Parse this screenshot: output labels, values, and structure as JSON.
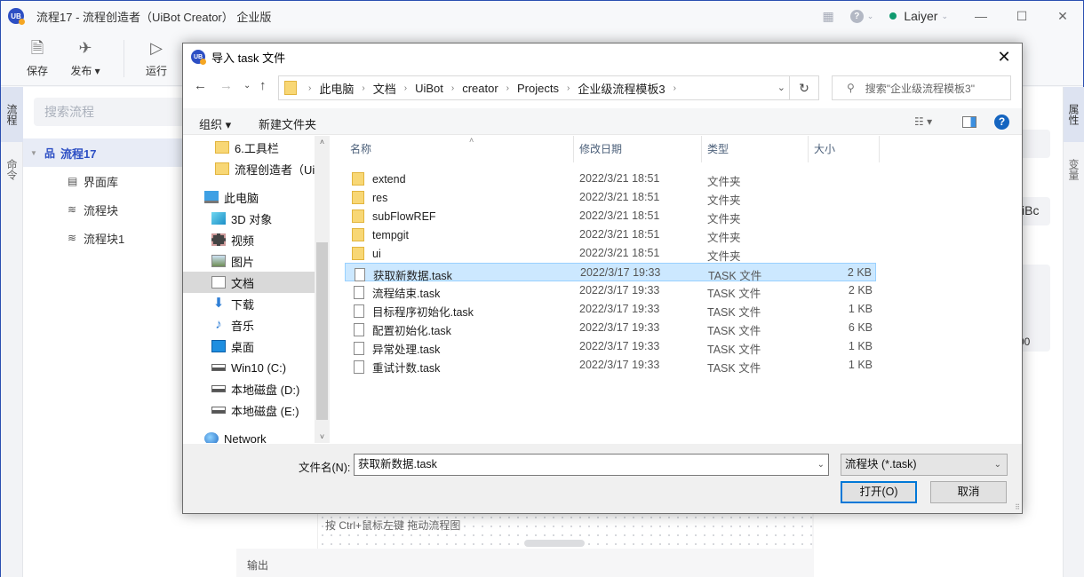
{
  "app": {
    "logo_text": "UB",
    "title": "流程17 - 流程创造者（UiBot Creator） 企业版",
    "user_name": "Laiyer",
    "status_color": "#0f9a6f",
    "icons": {
      "apps": "▦",
      "help": "?",
      "chevron": "⌄",
      "minimize": "—",
      "maximize": "☐",
      "close": "✕"
    }
  },
  "toolbar": {
    "items": [
      {
        "label": "保存",
        "icon": "🗎"
      },
      {
        "label": "发布 ▾",
        "icon": "✈"
      },
      {
        "label": "运行",
        "icon": "▷"
      }
    ]
  },
  "left_strip": {
    "tabs": [
      "流程",
      "命令"
    ]
  },
  "left_panel": {
    "search_placeholder": "搜索流程",
    "tree": [
      {
        "label": "流程17",
        "icon": "品",
        "caret": "▼"
      },
      {
        "label": "界面库",
        "icon": "▤"
      },
      {
        "label": "流程块",
        "icon": "≋"
      },
      {
        "label": "流程块1",
        "icon": "≋"
      }
    ]
  },
  "center": {
    "canvas_hint": "按 Ctrl+鼠标左键 拖动流程图",
    "output_label": "输出"
  },
  "right_panel": {
    "partial_text_1": "iBc",
    "partial_text_2": "00"
  },
  "right_strip": {
    "tabs": [
      "属性",
      "变量"
    ]
  },
  "dialog": {
    "title": "导入 task 文件",
    "close_icon": "✕",
    "nav": {
      "back": "←",
      "forward": "→",
      "recent": "⌄",
      "up": "↑",
      "refresh": "↻"
    },
    "breadcrumb": [
      "此电脑",
      "文档",
      "UiBot",
      "creator",
      "Projects",
      "企业级流程模板3"
    ],
    "crumb_sep": "›",
    "addr_dropdown": "⌄",
    "search_placeholder": "搜索\"企业级流程模板3\"",
    "search_icon": "⚲",
    "commands": {
      "organize": "组织 ▾",
      "new_folder": "新建文件夹",
      "view_icon": "☷ ▾",
      "help": "?"
    },
    "nav_pane": [
      {
        "label": "6.工具栏",
        "icon": "folder"
      },
      {
        "label": "流程创造者（UiBot Creator）",
        "icon": "folder"
      },
      {
        "label": "此电脑",
        "icon": "pc"
      },
      {
        "label": "3D 对象",
        "icon": "3d"
      },
      {
        "label": "视频",
        "icon": "video"
      },
      {
        "label": "图片",
        "icon": "pic"
      },
      {
        "label": "文档",
        "icon": "doc",
        "selected": true
      },
      {
        "label": "下载",
        "icon": "dl"
      },
      {
        "label": "音乐",
        "icon": "music"
      },
      {
        "label": "桌面",
        "icon": "desk"
      },
      {
        "label": "Win10 (C:)",
        "icon": "drive"
      },
      {
        "label": "本地磁盘 (D:)",
        "icon": "drive"
      },
      {
        "label": "本地磁盘 (E:)",
        "icon": "drive"
      },
      {
        "label": "Network",
        "icon": "net"
      }
    ],
    "scroll": {
      "up": "˄",
      "down": "˅"
    },
    "columns": {
      "name": "名称",
      "date": "修改日期",
      "type": "类型",
      "size": "大小",
      "sort_indicator": "˄"
    },
    "files": [
      {
        "name": "extend",
        "date": "2022/3/21 18:51",
        "type": "文件夹",
        "size": "",
        "kind": "folder"
      },
      {
        "name": "res",
        "date": "2022/3/21 18:51",
        "type": "文件夹",
        "size": "",
        "kind": "folder"
      },
      {
        "name": "subFlowREF",
        "date": "2022/3/21 18:51",
        "type": "文件夹",
        "size": "",
        "kind": "folder"
      },
      {
        "name": "tempgit",
        "date": "2022/3/21 18:51",
        "type": "文件夹",
        "size": "",
        "kind": "folder"
      },
      {
        "name": "ui",
        "date": "2022/3/21 18:51",
        "type": "文件夹",
        "size": "",
        "kind": "folder"
      },
      {
        "name": "获取新数据.task",
        "date": "2022/3/17 19:33",
        "type": "TASK 文件",
        "size": "2 KB",
        "kind": "file",
        "selected": true
      },
      {
        "name": "流程结束.task",
        "date": "2022/3/17 19:33",
        "type": "TASK 文件",
        "size": "2 KB",
        "kind": "file"
      },
      {
        "name": "目标程序初始化.task",
        "date": "2022/3/17 19:33",
        "type": "TASK 文件",
        "size": "1 KB",
        "kind": "file"
      },
      {
        "name": "配置初始化.task",
        "date": "2022/3/17 19:33",
        "type": "TASK 文件",
        "size": "6 KB",
        "kind": "file"
      },
      {
        "name": "异常处理.task",
        "date": "2022/3/17 19:33",
        "type": "TASK 文件",
        "size": "1 KB",
        "kind": "file"
      },
      {
        "name": "重试计数.task",
        "date": "2022/3/17 19:33",
        "type": "TASK 文件",
        "size": "1 KB",
        "kind": "file"
      }
    ],
    "filename_label": "文件名(N):",
    "filename_value": "获取新数据.task",
    "filter_value": "流程块 (*.task)",
    "open_label": "打开(O)",
    "cancel_label": "取消",
    "dropdown_icon": "⌄",
    "grip": "⠿"
  }
}
